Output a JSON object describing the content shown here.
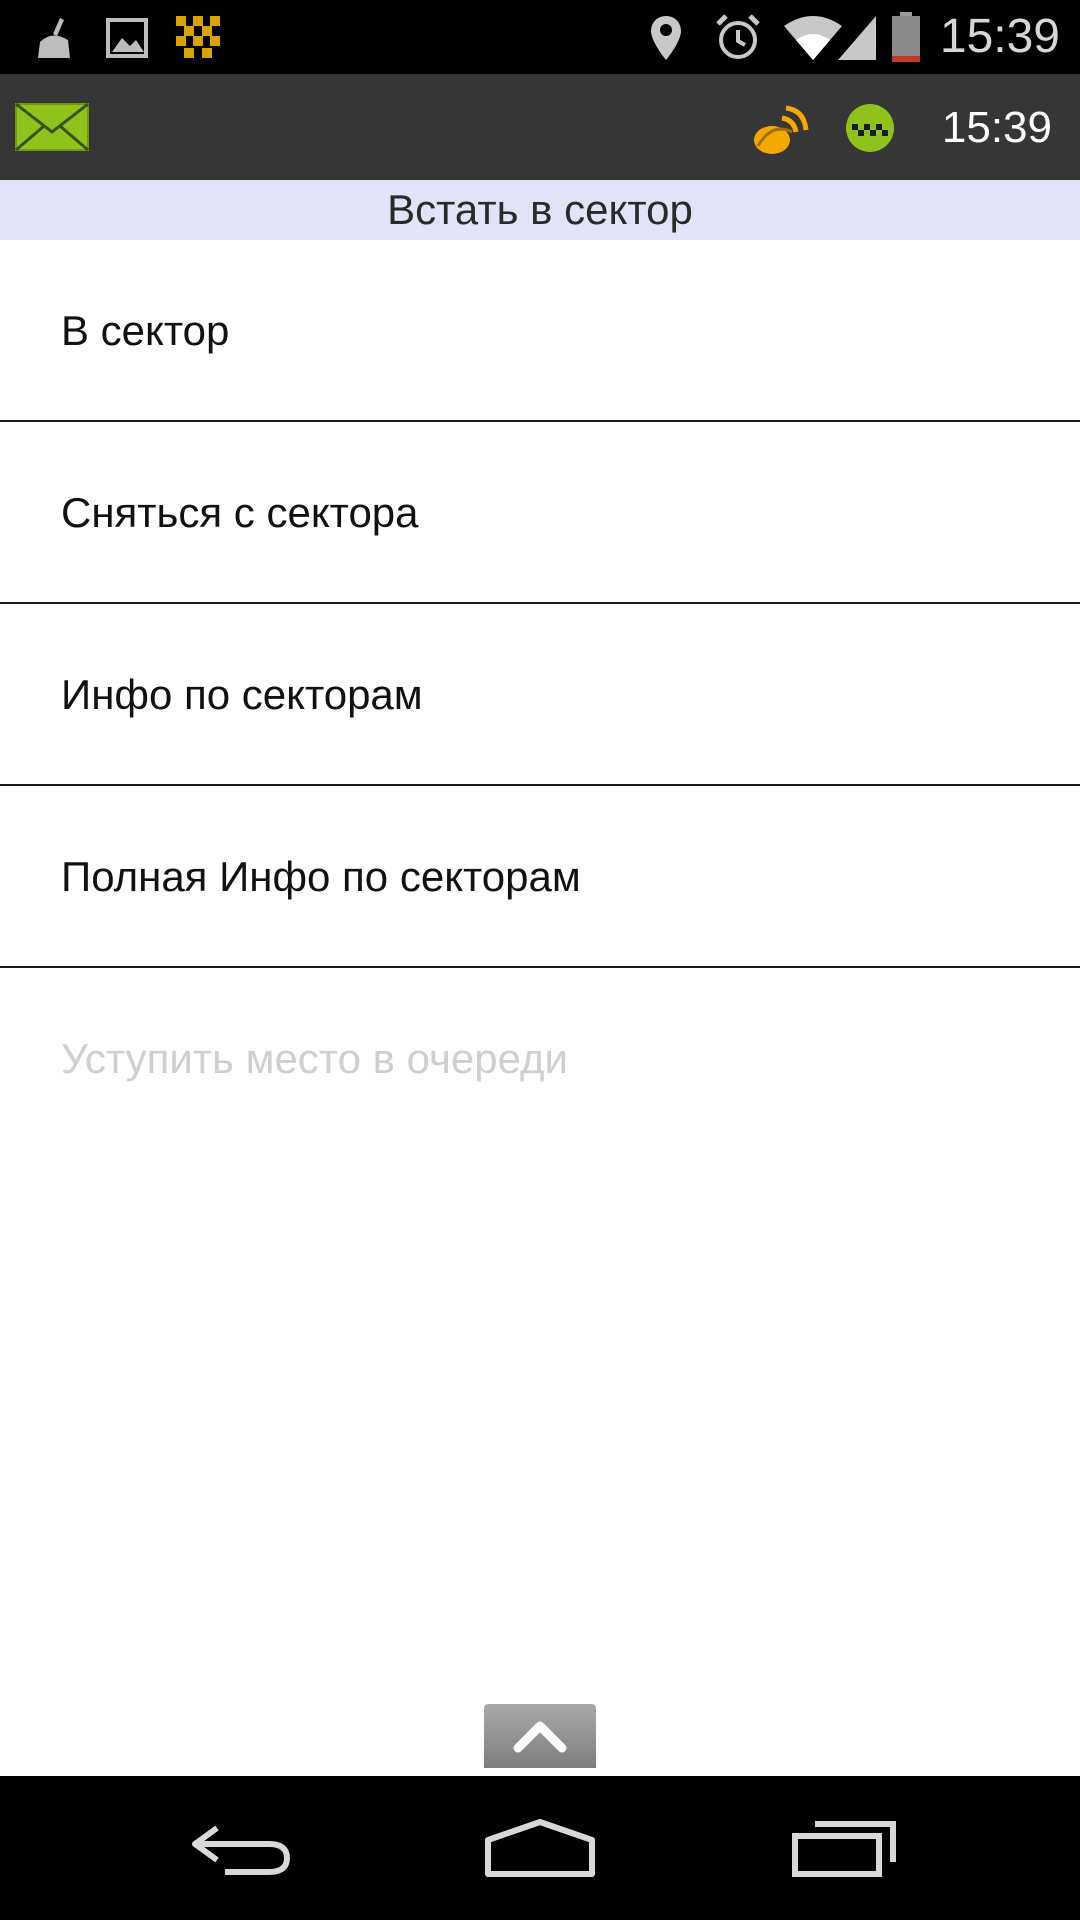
{
  "status_bar": {
    "time": "15:39",
    "icons": [
      "cleaner-icon",
      "gallery-icon",
      "taxi-grid-icon",
      "location-icon",
      "alarm-icon",
      "wifi-icon",
      "signal-icon",
      "battery-icon"
    ],
    "battery_color": "#c0392b"
  },
  "app_bar": {
    "time": "15:39",
    "icons": [
      "mail-icon",
      "satellite-icon",
      "taxi-icon"
    ],
    "accent_color": "#8fc21b",
    "satellite_color": "#f5a800"
  },
  "screen": {
    "title": "Встать в сектор"
  },
  "menu": {
    "items": [
      {
        "label": "В сектор",
        "enabled": true
      },
      {
        "label": "Сняться с сектора",
        "enabled": true
      },
      {
        "label": "Инфо по секторам",
        "enabled": true
      },
      {
        "label": "Полная Инфо по секторам",
        "enabled": true
      },
      {
        "label": "Уступить место в очереди",
        "enabled": false
      }
    ]
  },
  "navigation": {
    "icons": [
      "back-icon",
      "home-icon",
      "recent-apps-icon"
    ]
  }
}
